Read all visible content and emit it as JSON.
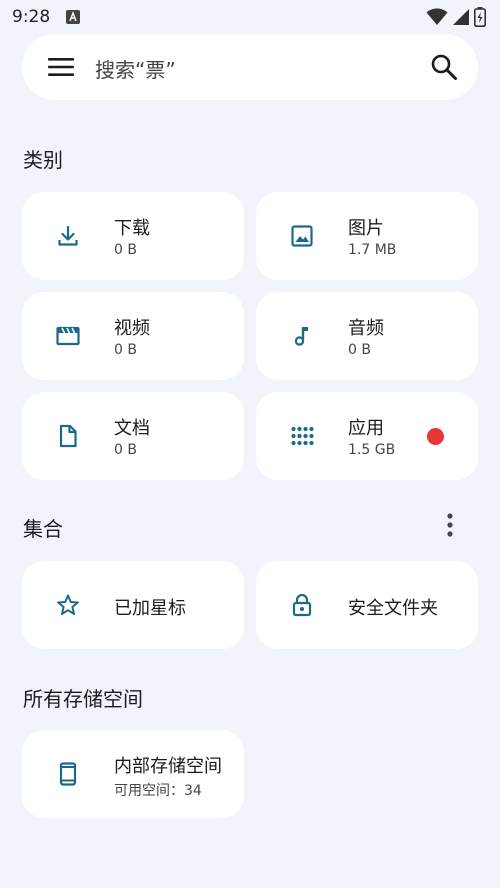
{
  "status": {
    "time": "9:28"
  },
  "search": {
    "placeholder": "搜索“票”"
  },
  "sections": {
    "categories": "类别",
    "collections": "集合",
    "storage": "所有存储空间"
  },
  "categories": {
    "downloads": {
      "title": "下载",
      "size": "0 B"
    },
    "images": {
      "title": "图片",
      "size": "1.7 MB"
    },
    "videos": {
      "title": "视频",
      "size": "0 B"
    },
    "audio": {
      "title": "音频",
      "size": "0 B"
    },
    "documents": {
      "title": "文档",
      "size": "0 B"
    },
    "apps": {
      "title": "应用",
      "size": "1.5 GB"
    }
  },
  "collections": {
    "starred": {
      "title": "已加星标"
    },
    "safe_folder": {
      "title": "安全文件夹"
    }
  },
  "storage": {
    "internal": {
      "title": "内部存储空间",
      "subtitle": "可用空间：34"
    }
  },
  "colors": {
    "accent": "#1b6a8a",
    "background": "#f2f4fc",
    "card": "#ffffff",
    "badge": "#e53935"
  }
}
